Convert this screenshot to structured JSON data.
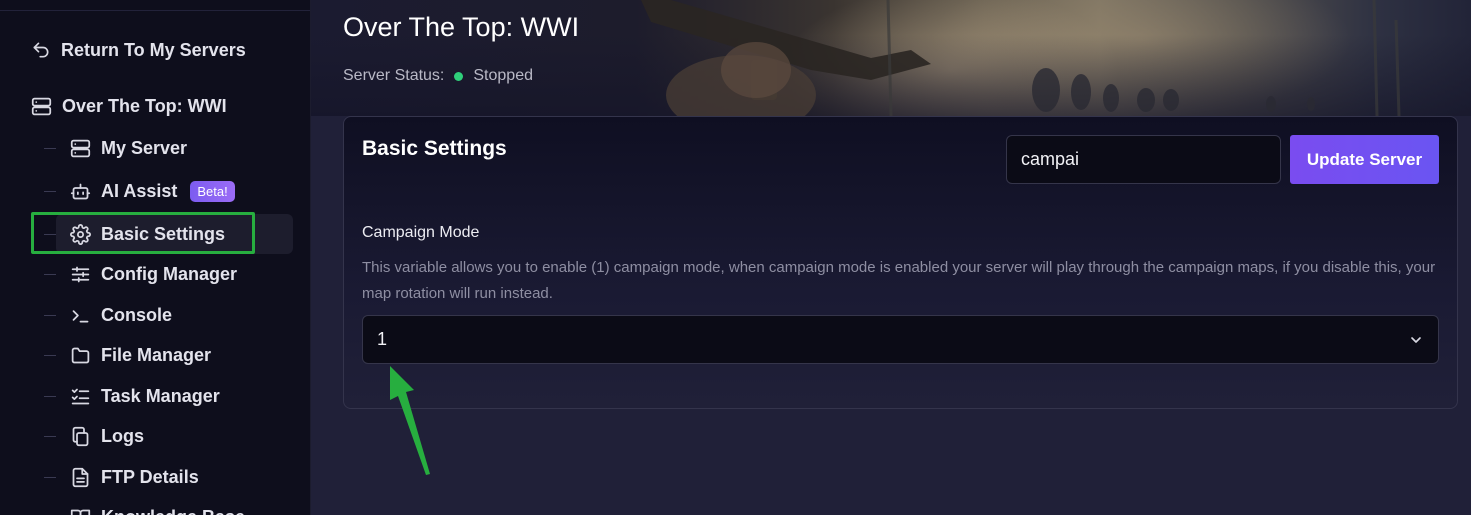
{
  "sidebar": {
    "return_label": "Return To My Servers",
    "server_name": "Over The Top: WWI",
    "items": [
      {
        "label": "My Server",
        "icon": "server-icon"
      },
      {
        "label": "AI Assist",
        "icon": "robot-icon",
        "badge": "Beta!"
      },
      {
        "label": "Basic Settings",
        "icon": "gear-icon",
        "active": true
      },
      {
        "label": "Config Manager",
        "icon": "sliders-icon"
      },
      {
        "label": "Console",
        "icon": "terminal-icon"
      },
      {
        "label": "File Manager",
        "icon": "folder-icon"
      },
      {
        "label": "Task Manager",
        "icon": "checklist-icon"
      },
      {
        "label": "Logs",
        "icon": "copy-icon"
      },
      {
        "label": "FTP Details",
        "icon": "file-icon"
      },
      {
        "label": "Knowledge Base",
        "icon": "book-icon"
      }
    ]
  },
  "header": {
    "title": "Over The Top: WWI",
    "status_label": "Server Status:",
    "status_value": "Stopped",
    "status_color": "#2fcf7a"
  },
  "card": {
    "title": "Basic Settings",
    "search_value": "campai",
    "update_button": "Update Server",
    "field": {
      "label": "Campaign Mode",
      "description": "This variable allows you to enable (1) campaign mode, when campaign mode is enabled your server will play through the campaign maps, if you disable this, your map rotation will run instead.",
      "selected_value": "1"
    }
  },
  "colors": {
    "accent": "#7a4cf0",
    "annotation": "#27ae3f"
  }
}
